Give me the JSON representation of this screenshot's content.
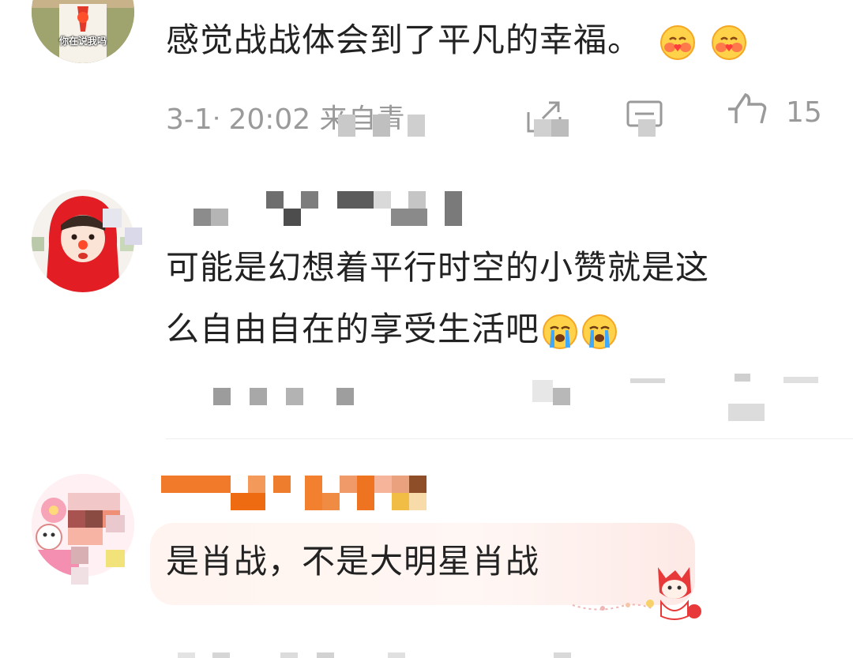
{
  "comments": [
    {
      "avatar_caption": "你在说我吗",
      "text": "感觉战战体会到了平凡的幸福。",
      "meta": "3-1ᐧ 20:02 来自青",
      "like_count": "15"
    },
    {
      "text_line1": "可能是幻想着平行时空的小赞就是这",
      "text_line2": "么自由自在的享受生活吧"
    },
    {
      "text": "是肖战，不是大明星肖战"
    }
  ],
  "colors": {
    "text": "#222222",
    "meta": "#9a9a9a",
    "vip_name": "#f07a2a"
  }
}
